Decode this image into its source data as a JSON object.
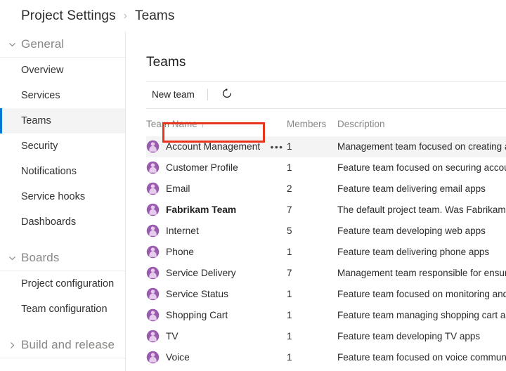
{
  "breadcrumb": {
    "root": "Project Settings",
    "separator": "›",
    "current": "Teams"
  },
  "sidebar": {
    "groups": [
      {
        "label": "General",
        "expanded": true,
        "chevron": "chevron-down-icon",
        "items": [
          {
            "label": "Overview",
            "selected": false
          },
          {
            "label": "Services",
            "selected": false
          },
          {
            "label": "Teams",
            "selected": true
          },
          {
            "label": "Security",
            "selected": false
          },
          {
            "label": "Notifications",
            "selected": false
          },
          {
            "label": "Service hooks",
            "selected": false
          },
          {
            "label": "Dashboards",
            "selected": false
          }
        ]
      },
      {
        "label": "Boards",
        "expanded": true,
        "chevron": "chevron-down-icon",
        "items": [
          {
            "label": "Project configuration",
            "selected": false
          },
          {
            "label": "Team configuration",
            "selected": false
          }
        ]
      },
      {
        "label": "Build and release",
        "expanded": false,
        "chevron": "chevron-right-icon",
        "items": []
      }
    ]
  },
  "main": {
    "title": "Teams",
    "toolbar": {
      "new_team_label": "New team",
      "refresh_icon": "refresh-icon"
    },
    "table": {
      "columns": [
        {
          "key": "name",
          "label": "Team Name",
          "sorted": true,
          "sort_arrow": "↑"
        },
        {
          "key": "members",
          "label": "Members",
          "sorted": false,
          "sort_arrow": ""
        },
        {
          "key": "description",
          "label": "Description",
          "sorted": false,
          "sort_arrow": ""
        }
      ],
      "rows": [
        {
          "name": "Account Management",
          "members": "1",
          "description": "Management team focused on creating and",
          "bold": false,
          "hovered": true,
          "show_ellipsis": true,
          "annotated": true
        },
        {
          "name": "Customer Profile",
          "members": "1",
          "description": "Feature team focused on securing account",
          "bold": false,
          "hovered": false,
          "show_ellipsis": false,
          "annotated": false
        },
        {
          "name": "Email",
          "members": "2",
          "description": "Feature team delivering email apps",
          "bold": false,
          "hovered": false,
          "show_ellipsis": false,
          "annotated": false
        },
        {
          "name": "Fabrikam Team",
          "members": "7",
          "description": "The default project team. Was Fabrikam Fi",
          "bold": true,
          "hovered": false,
          "show_ellipsis": false,
          "annotated": false
        },
        {
          "name": "Internet",
          "members": "5",
          "description": "Feature team developing web apps",
          "bold": false,
          "hovered": false,
          "show_ellipsis": false,
          "annotated": false
        },
        {
          "name": "Phone",
          "members": "1",
          "description": "Feature team delivering phone apps",
          "bold": false,
          "hovered": false,
          "show_ellipsis": false,
          "annotated": false
        },
        {
          "name": "Service Delivery",
          "members": "7",
          "description": "Management team responsible for ensure",
          "bold": false,
          "hovered": false,
          "show_ellipsis": false,
          "annotated": false
        },
        {
          "name": "Service Status",
          "members": "1",
          "description": "Feature team focused on monitoring and ",
          "bold": false,
          "hovered": false,
          "show_ellipsis": false,
          "annotated": false
        },
        {
          "name": "Shopping Cart",
          "members": "1",
          "description": "Feature team managing shopping cart app",
          "bold": false,
          "hovered": false,
          "show_ellipsis": false,
          "annotated": false
        },
        {
          "name": "TV",
          "members": "1",
          "description": "Feature team developing TV apps",
          "bold": false,
          "hovered": false,
          "show_ellipsis": false,
          "annotated": false
        },
        {
          "name": "Voice",
          "members": "1",
          "description": "Feature team focused on voice communic",
          "bold": false,
          "hovered": false,
          "show_ellipsis": false,
          "annotated": false
        }
      ],
      "row_menu_glyph": "•••"
    }
  },
  "colors": {
    "accent": "#0078d4",
    "annotation": "#e8341c",
    "avatar_purple": "#8f4fa8",
    "avatar_fill": "#dfc0e8",
    "row_hover": "#f4f4f4",
    "muted_text": "#8a8886"
  }
}
